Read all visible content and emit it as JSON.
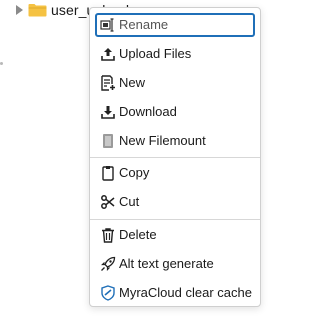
{
  "tree": {
    "folder_label": "user_upload"
  },
  "menu": {
    "items": [
      {
        "label": "Rename",
        "icon": "rename-icon"
      },
      {
        "label": "Upload Files",
        "icon": "upload-icon"
      },
      {
        "label": "New",
        "icon": "new-file-icon"
      },
      {
        "label": "Download",
        "icon": "download-icon"
      },
      {
        "label": "New Filemount",
        "icon": "filemount-icon"
      },
      {
        "label": "Copy",
        "icon": "copy-icon"
      },
      {
        "label": "Cut",
        "icon": "scissors-icon"
      },
      {
        "label": "Delete",
        "icon": "trash-icon"
      },
      {
        "label": "Alt text generate",
        "icon": "rocket-icon"
      },
      {
        "label": "MyraCloud clear cache",
        "icon": "shield-icon"
      }
    ]
  },
  "colors": {
    "focus_border": "#1f6fb8",
    "folder": "#f5c242",
    "shield_accent": "#1f6fb8"
  }
}
